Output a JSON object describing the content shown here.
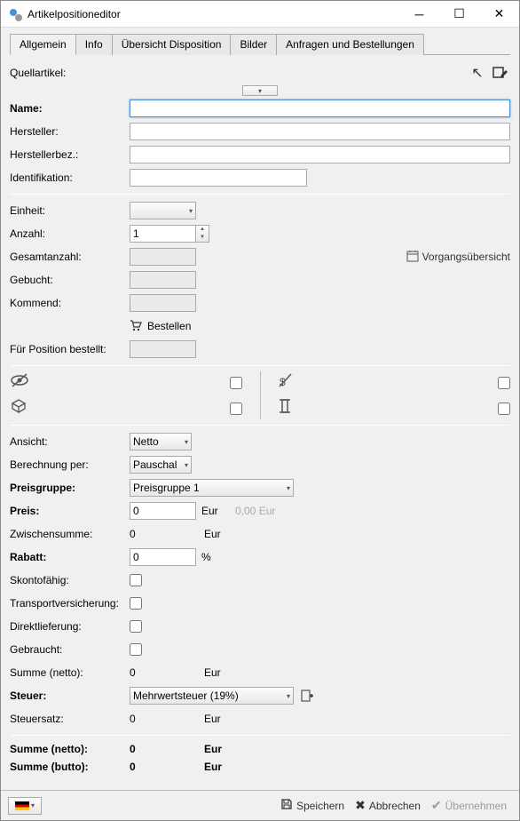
{
  "window": {
    "title": "Artikelpositioneditor"
  },
  "tabs": [
    "Allgemein",
    "Info",
    "Übersicht Disposition",
    "Bilder",
    "Anfragen und Bestellungen"
  ],
  "labels": {
    "quellartikel": "Quellartikel:",
    "name": "Name:",
    "hersteller": "Hersteller:",
    "herstellerbez": "Herstellerbez.:",
    "identifikation": "Identifikation:",
    "einheit": "Einheit:",
    "anzahl": "Anzahl:",
    "gesamtanzahl": "Gesamtanzahl:",
    "gebucht": "Gebucht:",
    "kommend": "Kommend:",
    "bestellen": "Bestellen",
    "fuer_position": "Für Position bestellt:",
    "vorgang": "Vorgangsübersicht",
    "ansicht": "Ansicht:",
    "berechnung": "Berechnung per:",
    "preisgruppe": "Preisgruppe:",
    "preis": "Preis:",
    "zwischensumme": "Zwischensumme:",
    "rabatt": "Rabatt:",
    "skonto": "Skontofähig:",
    "transport": "Transportversicherung:",
    "direkt": "Direktlieferung:",
    "gebraucht": "Gebraucht:",
    "summe_netto": "Summe (netto):",
    "steuer": "Steuer:",
    "steuersatz": "Steuersatz:",
    "summe_netto2": "Summe (netto):",
    "summe_brutto": "Summe (butto):"
  },
  "values": {
    "anzahl": "1",
    "ansicht": "Netto",
    "berechnung": "Pauschal",
    "preisgruppe": "Preisgruppe 1",
    "preis": "0",
    "preis_hint": "0,00 Eur",
    "zwischensumme": "0",
    "rabatt": "0",
    "summe_netto": "0",
    "steuer": "Mehrwertsteuer (19%)",
    "steuersatz": "0",
    "summe_netto2": "0",
    "summe_brutto": "0",
    "eur": "Eur",
    "pct": "%"
  },
  "footer": {
    "speichern": "Speichern",
    "abbrechen": "Abbrechen",
    "uebernehmen": "Übernehmen"
  }
}
